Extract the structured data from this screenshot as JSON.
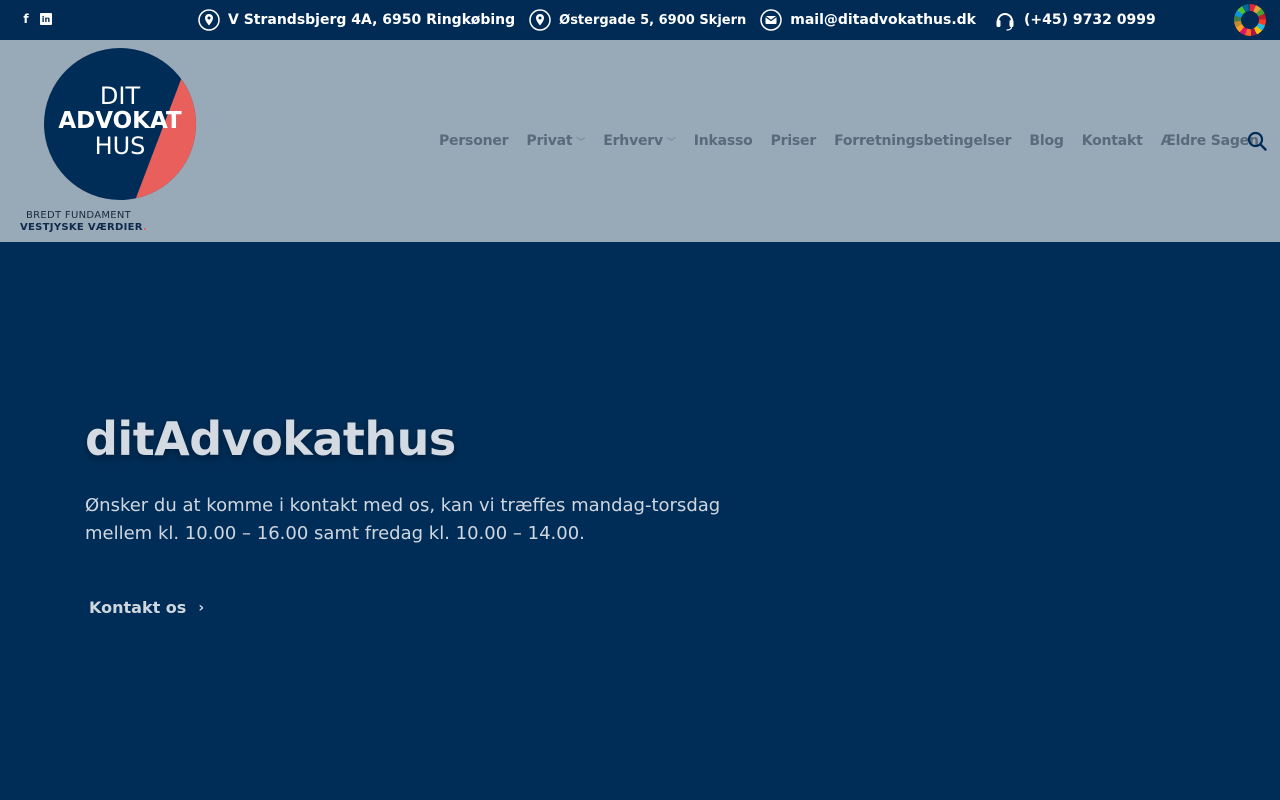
{
  "topbar": {
    "social": {
      "facebook": "f",
      "linkedin": "in"
    },
    "contacts": [
      {
        "icon": "location-pin-icon",
        "text": "V Strandsbjerg 4A, 6950 Ringkøbing"
      },
      {
        "icon": "location-pin-icon",
        "text": "Østergade 5, 6900 Skjern"
      },
      {
        "icon": "envelope-icon",
        "text": "mail@ditadvokathus.dk"
      },
      {
        "icon": "headset-icon",
        "text": "(+45) 9732 0999"
      }
    ]
  },
  "logo": {
    "line1": "DIT",
    "line2": "ADVOKAT",
    "line3": "HUS",
    "tagline1": "BREDT FUNDAMENT",
    "tagline2": "VESTJYSKE VÆRDIER",
    "tagline_dot": "."
  },
  "nav": {
    "items": [
      {
        "label": "Personer",
        "dropdown": false
      },
      {
        "label": "Privat",
        "dropdown": true
      },
      {
        "label": "Erhverv",
        "dropdown": true
      },
      {
        "label": "Inkasso",
        "dropdown": false
      },
      {
        "label": "Priser",
        "dropdown": false
      },
      {
        "label": "Forretningsbetingelser",
        "dropdown": false
      },
      {
        "label": "Blog",
        "dropdown": false
      },
      {
        "label": "Kontakt",
        "dropdown": false
      },
      {
        "label": "Ældre Sagen",
        "dropdown": false
      }
    ],
    "chevron": "﹀"
  },
  "hero": {
    "title": "ditAdvokathus",
    "text": "Ønsker du at komme i kontakt med os, kan vi træffes mandag-torsdag mellem kl. 10.00 – 16.00 samt fredag kl. 10.00 – 14.00.",
    "button_label": "Kontakt os",
    "button_arrow": "›"
  },
  "colors": {
    "topbar": "#012b55",
    "header": "#98a9b7",
    "hero": "#002d57",
    "accent_red": "#e85f5c"
  }
}
